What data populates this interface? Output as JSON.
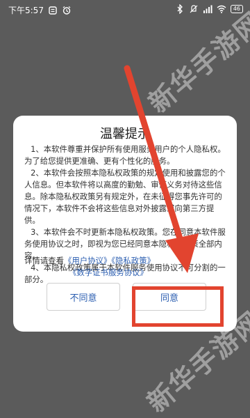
{
  "status_bar": {
    "time": "下午5:57",
    "battery": "46"
  },
  "watermark": {
    "text": "新华手游网"
  },
  "dialog": {
    "title": "温馨提示",
    "paragraphs": [
      "1、本软件尊重并保护所有使用服务用户的个人隐私权。为了给您提供更准确、更有个性化的服务。",
      "2、本软件会按照本隐私权政策的规定使用和披露您的个人信息。但本软件将以高度的勤勉、审慎义务对待这些信息。除本隐私权政策另有规定外，在未征得您事先许可的情况下，本软件不会将这些信息对外披露或向第三方提供。",
      "3、本软件会不时更新本隐私权政策。您在同意本软件服务使用协议之时，即视为您已经同意本隐私权政策全部内容。",
      "4、本隐私权政策属于本软件服务使用协议不可分割的一部分。"
    ],
    "details_prefix": "详情请查看",
    "user_agreement_link": "《用户协议》",
    "privacy_policy_link": "《隐私政策》",
    "cert_agreement_link": "《数字证书服务协议》",
    "disagree_label": "不同意",
    "agree_label": "同意"
  },
  "colors": {
    "accent_link": "#2a5db0",
    "highlight": "#e2442f",
    "overlay_bg": "#5b5b5b"
  }
}
